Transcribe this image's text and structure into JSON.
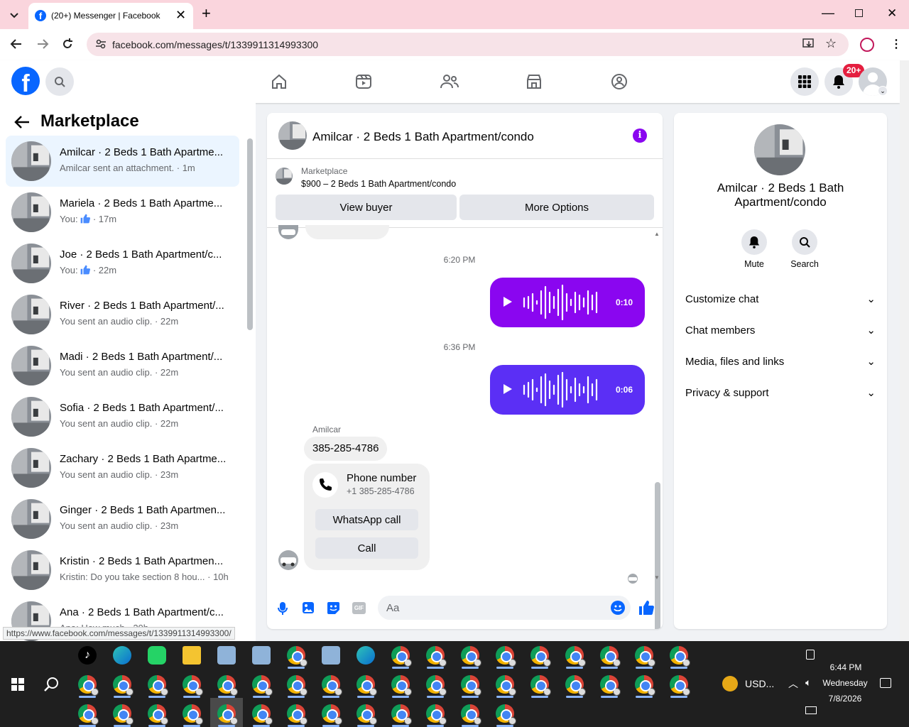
{
  "browser": {
    "tab_title": "(20+) Messenger | Facebook",
    "url": "facebook.com/messages/t/1339911314993300",
    "status_url": "https://www.facebook.com/messages/t/1339911314993300/"
  },
  "header": {
    "notification_badge": "20+",
    "nav_icons": [
      "home-icon",
      "reels-icon",
      "friends-icon",
      "marketplace-icon",
      "gaming-icon"
    ]
  },
  "sidebar": {
    "title": "Marketplace",
    "conversations": [
      {
        "name": "Amilcar · 2 Beds 1 Bath Apartme...",
        "preview": "Amilcar sent an attachment.",
        "time": "· 1m",
        "has_like": false
      },
      {
        "name": "Mariela · 2 Beds 1 Bath Apartme...",
        "preview": "You:",
        "time": "· 17m",
        "has_like": true
      },
      {
        "name": "Joe · 2 Beds 1 Bath Apartment/c...",
        "preview": "You:",
        "time": "· 22m",
        "has_like": true
      },
      {
        "name": "River · 2 Beds 1 Bath Apartment/...",
        "preview": "You sent an audio clip.",
        "time": "· 22m",
        "has_like": false
      },
      {
        "name": "Madi · 2 Beds 1 Bath Apartment/...",
        "preview": "You sent an audio clip.",
        "time": "· 22m",
        "has_like": false
      },
      {
        "name": "Sofia · 2 Beds 1 Bath Apartment/...",
        "preview": "You sent an audio clip.",
        "time": "· 22m",
        "has_like": false
      },
      {
        "name": "Zachary · 2 Beds 1 Bath Apartme...",
        "preview": "You sent an audio clip.",
        "time": "· 23m",
        "has_like": false
      },
      {
        "name": "Ginger · 2 Beds 1 Bath Apartmen...",
        "preview": "You sent an audio clip.",
        "time": "· 23m",
        "has_like": false
      },
      {
        "name": "Kristin · 2 Beds 1 Bath Apartmen...",
        "preview": "Kristin: Do you take section 8 hou...",
        "time": "· 10h",
        "has_like": false
      },
      {
        "name": "Ana · 2 Beds 1 Bath Apartment/c...",
        "preview": "Ana: How much",
        "time": "· 20h",
        "has_like": false
      }
    ]
  },
  "chat": {
    "title": "Amilcar · 2 Beds 1 Bath Apartment/condo",
    "listing_label": "Marketplace",
    "listing_price_title": "$900 – 2 Beds 1 Bath Apartment/condo",
    "view_buyer": "View buyer",
    "more_options": "More Options",
    "messages": {
      "time1": "6:20 PM",
      "audio1_duration": "0:10",
      "time2": "6:36 PM",
      "audio2_duration": "0:06",
      "sender": "Amilcar",
      "phone_text": "385-285-4786",
      "card_title": "Phone number",
      "card_number": "+1 385-285-4786",
      "whatsapp_call": "WhatsApp call",
      "call": "Call"
    },
    "composer_placeholder": "Aa"
  },
  "info_panel": {
    "name": "Amilcar · 2 Beds 1 Bath Apartment/condo",
    "mute": "Mute",
    "search": "Search",
    "sections": [
      "Customize chat",
      "Chat members",
      "Media, files and links",
      "Privacy & support"
    ]
  },
  "taskbar": {
    "currency": "USD...",
    "time": "6:44 PM",
    "day": "Wednesday",
    "date": "7/8/2026"
  },
  "colors": {
    "fb_blue": "#0866ff",
    "messenger_purple_1": "#8a06f0",
    "messenger_purple_2": "#5b2ff5",
    "notification_red": "#e41e3f",
    "tabbar_pink": "#fad5dd"
  }
}
